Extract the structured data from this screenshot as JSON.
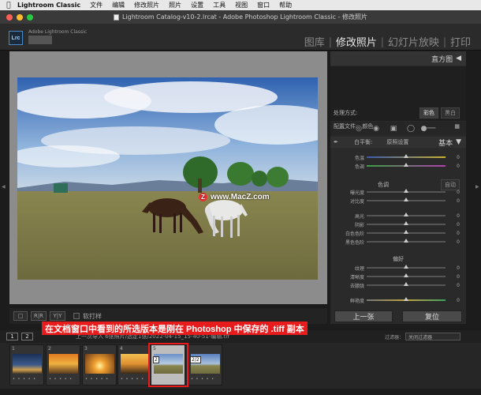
{
  "menubar": {
    "apple_icon": "apple-icon",
    "app_name": "Lightroom Classic",
    "items": [
      "文件",
      "编辑",
      "修改照片",
      "照片",
      "设置",
      "工具",
      "视图",
      "窗口",
      "帮助"
    ]
  },
  "window": {
    "title": "Lightroom Catalog-v10-2.lrcat - Adobe Photoshop Lightroom Classic - 修改照片"
  },
  "identity": {
    "logo_text": "Lrc",
    "brand": "Adobe Lightroom Classic"
  },
  "modules": {
    "library": "图库",
    "develop": "修改照片",
    "slideshow": "幻灯片放映",
    "print": "打印",
    "sep": "|"
  },
  "main": {
    "watermark_text": "www.MacZ.com",
    "watermark_badge": "Z"
  },
  "toolbar": {
    "view_icon": "loupe-view-icon",
    "compare_label": "R|R",
    "yy_label": "Y|Y",
    "soft_proof_label": "软打样"
  },
  "right_panel": {
    "histogram_label": "直方图",
    "basic_label": "基本",
    "treatment_label": "处理方式:",
    "treatment_color": "彩色",
    "treatment_bw": "黑白",
    "profile_label": "配置文件:",
    "profile_value": "颜色",
    "wb_label": "白平衡:",
    "wb_value": "原照设置",
    "temp_label": "色温",
    "tint_label": "色调",
    "tone_label": "色调",
    "auto_label": "自动",
    "exposure_label": "曝光度",
    "contrast_label": "对比度",
    "highlights_label": "高光",
    "shadows_label": "阴影",
    "whites_label": "白色色阶",
    "blacks_label": "黑色色阶",
    "presence_label": "偏好",
    "texture_label": "纹理",
    "clarity_label": "清晰度",
    "dehaze_label": "去朦胧",
    "vibrance_label": "鲜艳度",
    "zero": "0",
    "collapse_icon": "triangle-icon"
  },
  "buttons": {
    "previous": "上一张",
    "reset": "复位"
  },
  "filmstrip_head": {
    "screen1": "1",
    "screen2": "2",
    "nav_text": "上一次导入  6张照片/选定1张/2022-04-15_15-40-51-编辑.tif",
    "filter_label": "过滤器：",
    "filter_value": "关闭过滤器"
  },
  "caption": "在文档窗口中看到的所选版本是刚在 Photoshop 中保存的 .tiff 副本",
  "filmstrip": {
    "cells": [
      {
        "num": "1",
        "stars": "• • • • •"
      },
      {
        "num": "2",
        "stars": "• • • • •"
      },
      {
        "num": "3",
        "stars": "• • • • •"
      },
      {
        "num": "4",
        "stars": "• • • • •"
      },
      {
        "num": "5",
        "stars": "",
        "badge": "2"
      },
      {
        "num": "",
        "stars": "• • • • •",
        "badge": "2/2"
      }
    ]
  }
}
